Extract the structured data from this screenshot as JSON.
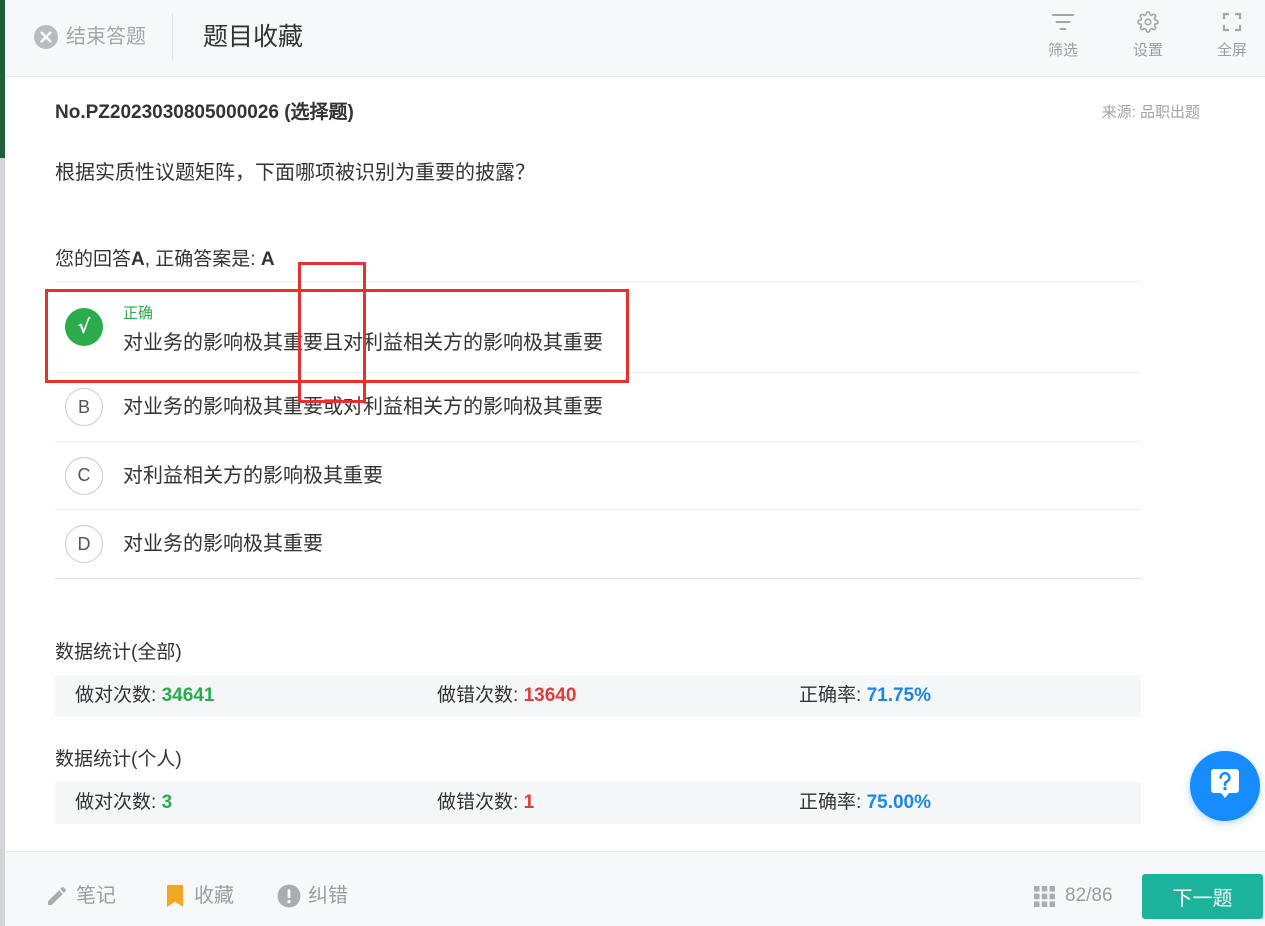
{
  "header": {
    "exit_label": "结束答题",
    "exit_icon": "close-circle-icon",
    "title": "题目收藏",
    "tools": [
      {
        "icon": "filter-icon",
        "label": "筛选"
      },
      {
        "icon": "gear-icon",
        "label": "设置"
      },
      {
        "icon": "fullscreen-icon",
        "label": "全屏"
      }
    ]
  },
  "question": {
    "number": "No.PZ2023030805000026 (选择题)",
    "source": "来源: 品职出题",
    "stem": "根据实质性议题矩阵，下面哪项被识别为重要的披露？",
    "answer_line": {
      "prefix": "您的回答",
      "user": "A",
      "middle": ", 正确答案是: ",
      "correct": "A"
    }
  },
  "options": [
    {
      "mark": "√",
      "status": "正确",
      "text": "对业务的影响极其重要且对利益相关方的影响极其重要"
    },
    {
      "letter": "B",
      "text": "对业务的影响极其重要或对利益相关方的影响极其重要"
    },
    {
      "letter": "C",
      "text": "对利益相关方的影响极其重要"
    },
    {
      "letter": "D",
      "text": "对业务的影响极其重要"
    }
  ],
  "stats": [
    {
      "title": "数据统计(全部)",
      "correct_label": "做对次数: ",
      "correct": "34641",
      "wrong_label": "做错次数: ",
      "wrong": "13640",
      "rate_label": "正确率: ",
      "rate": "71.75%"
    },
    {
      "title": "数据统计(个人)",
      "correct_label": "做对次数: ",
      "correct": "3",
      "wrong_label": "做错次数: ",
      "wrong": "1",
      "rate_label": "正确率: ",
      "rate": "75.00%"
    }
  ],
  "help_button": {
    "icon": "help-icon"
  },
  "footer": {
    "actions": [
      {
        "icon": "pencil-icon",
        "label": "笔记"
      },
      {
        "icon": "bookmark-icon",
        "label": "收藏"
      },
      {
        "icon": "exclamation-circle-icon",
        "label": "纠错"
      }
    ],
    "grid_icon": "grid-icon",
    "progress": "82/86",
    "next_label": "下一题"
  },
  "colors": {
    "correct": "#2aab4c",
    "wrong": "#e03c3c",
    "rate": "#1a87e8",
    "primary": "#1bb39b",
    "help": "#178cff",
    "bookmark": "#f5a623",
    "annotation": "#e8302c"
  }
}
